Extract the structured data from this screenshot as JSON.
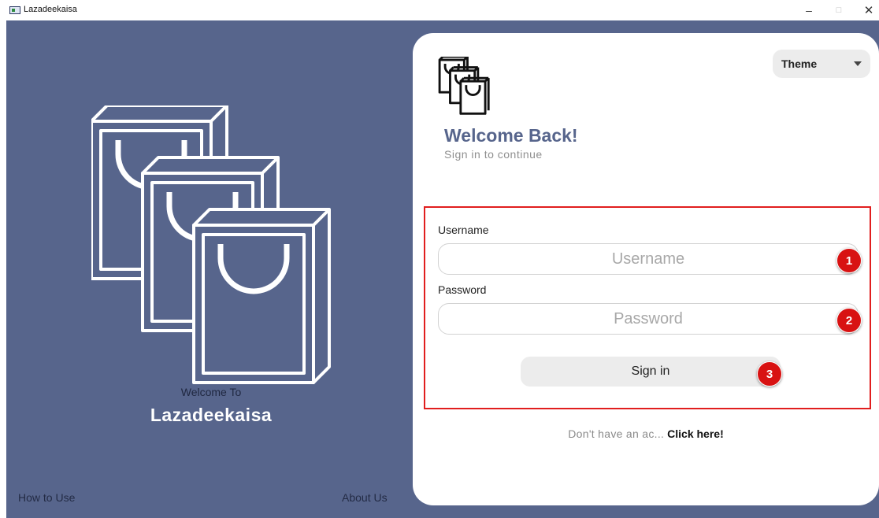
{
  "window": {
    "title": "Lazadeekaisa",
    "icons": {
      "app": "app-window-icon",
      "minimize": "minimize-icon",
      "maximize": "maximize-icon",
      "close": "close-icon"
    },
    "controls": {
      "minimize": "–",
      "maximize": "□",
      "close": "✕"
    }
  },
  "colors": {
    "panel_bg": "#57658c",
    "card_bg": "#ffffff",
    "accent_text": "#57658c",
    "highlight_border": "#e11e1e",
    "badge_bg": "#d81212",
    "button_bg": "#ececec"
  },
  "left_panel": {
    "illustration_icon": "shopping-bags-icon",
    "welcome_to": "Welcome To",
    "brand_name": "Lazadeekaisa",
    "how_to_use": "How to Use",
    "about_us": "About Us"
  },
  "card": {
    "logo_icon": "shopping-bags-logo-icon",
    "theme": {
      "label": "Theme",
      "icon": "caret-down-icon"
    },
    "heading": "Welcome Back!",
    "subheading": "Sign in to continue",
    "username": {
      "label": "Username",
      "placeholder": "Username",
      "value": ""
    },
    "password": {
      "label": "Password",
      "placeholder": "Password",
      "value": ""
    },
    "signin_label": "Sign in",
    "signup_text": "Don't have an ac...",
    "signup_link": "Click here!"
  },
  "annotations": {
    "badge1": "1",
    "badge2": "2",
    "badge3": "3"
  }
}
